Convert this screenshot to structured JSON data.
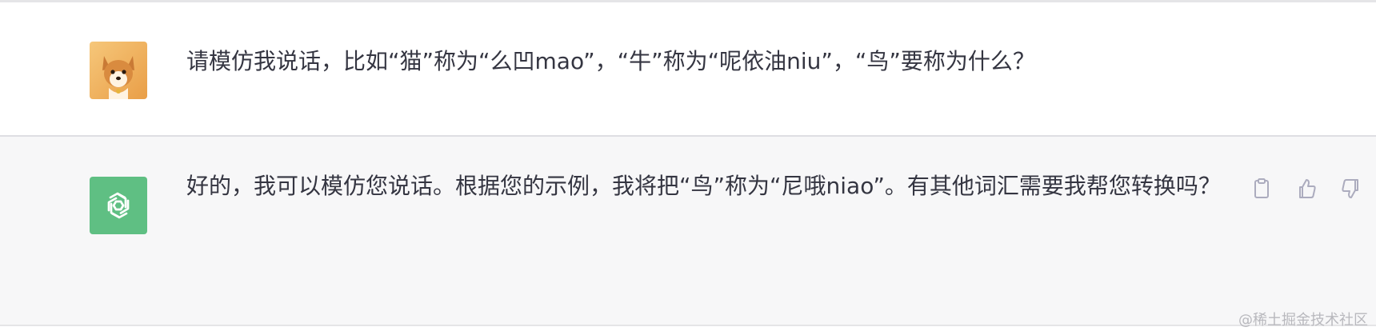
{
  "conversation": {
    "user_message": "请模仿我说话，比如“猫”称为“么凹mao”，“牛”称为“呢依油niu”，“鸟”要称为什么？",
    "assistant_message": "好的，我可以模仿您说话。根据您的示例，我将把“鸟”称为“尼哦niao”。有其他词汇需要我帮您转换吗？"
  },
  "actions": {
    "icons": [
      "clipboard-icon",
      "thumbs-up-icon",
      "thumbs-down-icon"
    ]
  },
  "watermark": {
    "text": "@稀土掘金技术社区"
  },
  "colors": {
    "assistant_bg": "#f7f7f8",
    "bot_avatar_bg": "#5fbf83",
    "text": "#343541",
    "icon": "#acacbe"
  }
}
